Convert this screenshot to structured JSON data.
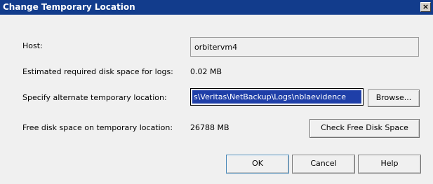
{
  "window": {
    "title": "Change Temporary Location",
    "close_label": "×"
  },
  "form": {
    "host_label": "Host:",
    "host_value": "orbitervm4",
    "disk_label": "Estimated required disk space for logs:",
    "disk_value": "0.02 MB",
    "alt_label": "Specify alternate temporary location:",
    "alt_value": "s\\Veritas\\NetBackup\\Logs\\nblaevidence",
    "free_label": "Free disk space on temporary location:",
    "free_value": "26788 MB"
  },
  "buttons": {
    "browse": "Browse...",
    "check": "Check Free Disk Space",
    "ok": "OK",
    "cancel": "Cancel",
    "help": "Help"
  }
}
